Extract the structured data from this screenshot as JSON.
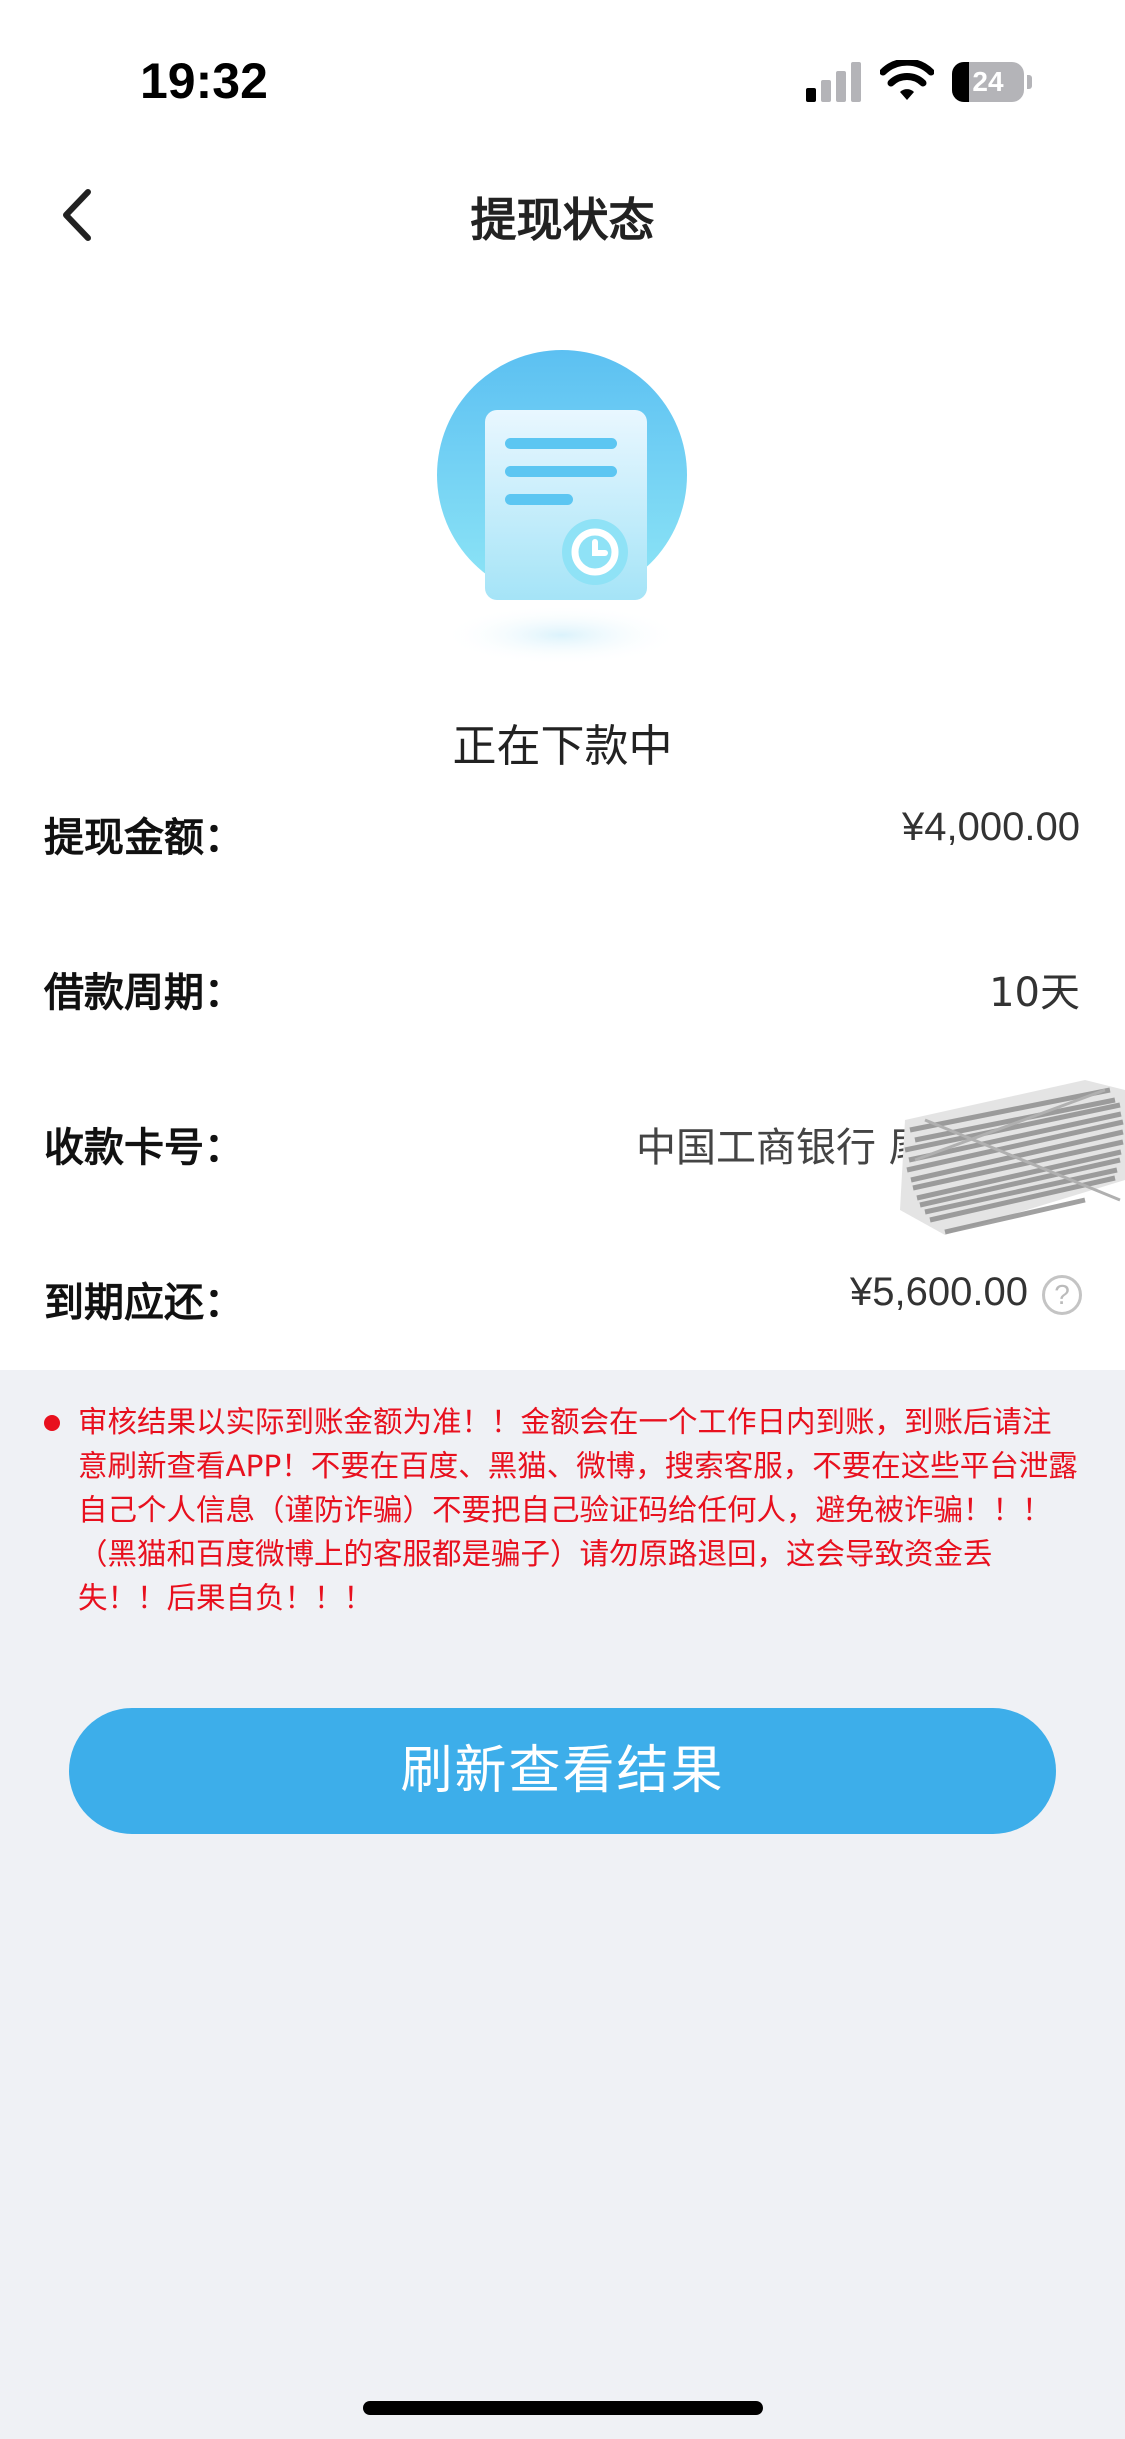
{
  "status_bar": {
    "time": "19:32",
    "battery_level": "24",
    "battery_fraction": 0.24,
    "icons": [
      "signal-icon",
      "wifi-icon",
      "battery-icon"
    ]
  },
  "header": {
    "back_icon": "chevron-left-icon",
    "title": "提现状态"
  },
  "status": {
    "icon": "document-clock-icon",
    "text": "正在下款中"
  },
  "info": {
    "amount_label": "提现金额：",
    "amount_value": "¥4,000.00",
    "period_label": "借款周期：",
    "period_value": "10天",
    "card_label": "收款卡号：",
    "card_value": "中国工商银行 尾",
    "due_label": "到期应还：",
    "due_value": "¥5,600.00",
    "due_help_icon": "question-circle-icon"
  },
  "notice": {
    "text": "审核结果以实际到账金额为准！！金额会在一个工作日内到账，到账后请注意刷新查看APP！不要在百度、黑猫、微博，搜索客服，不要在这些平台泄露自己个人信息（谨防诈骗）不要把自己验证码给任何人，避免被诈骗！！！（黑猫和百度微博上的客服都是骗子）请勿原路退回，这会导致资金丢失！！后果自负！！！"
  },
  "actions": {
    "refresh_label": "刷新查看结果"
  },
  "colors": {
    "accent": "#3daeea",
    "warning": "#e8101e",
    "background": "#eff1f5"
  }
}
